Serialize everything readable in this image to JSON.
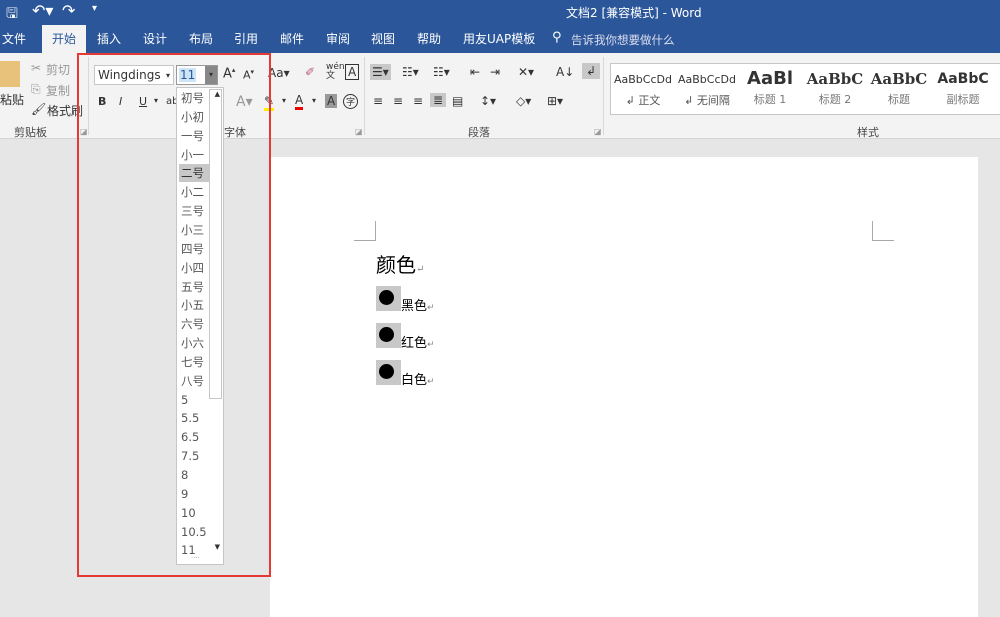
{
  "title_bar": {
    "title": "文档2 [兼容模式]  -  Word"
  },
  "tabs": [
    {
      "label": "文件"
    },
    {
      "label": "开始"
    },
    {
      "label": "插入"
    },
    {
      "label": "设计"
    },
    {
      "label": "布局"
    },
    {
      "label": "引用"
    },
    {
      "label": "邮件"
    },
    {
      "label": "审阅"
    },
    {
      "label": "视图"
    },
    {
      "label": "帮助"
    },
    {
      "label": "用友UAP模板"
    }
  ],
  "tell_me": "告诉我你想要做什么",
  "clipboard": {
    "paste": "粘贴",
    "cut": "剪切",
    "copy": "复制",
    "format_painter": "格式刷",
    "label": "剪贴板"
  },
  "font": {
    "name": "Wingdings",
    "size": "11",
    "label": "字体",
    "bold": "B",
    "italic": "I",
    "underline": "U"
  },
  "paragraph": {
    "label": "段落"
  },
  "styles": {
    "label": "样式",
    "items": [
      {
        "preview": "AaBbCcDd",
        "name": "↲ 正文"
      },
      {
        "preview": "AaBbCcDd",
        "name": "↲ 无间隔"
      },
      {
        "preview": "AaBl",
        "name": "标题 1"
      },
      {
        "preview": "AaBbC",
        "name": "标题 2"
      },
      {
        "preview": "AaBbC",
        "name": "标题"
      },
      {
        "preview": "AaBbC",
        "name": "副标题"
      }
    ]
  },
  "font_size_list": {
    "selected": "二号",
    "options": [
      "初号",
      "小初",
      "一号",
      "小一",
      "二号",
      "小二",
      "三号",
      "小三",
      "四号",
      "小四",
      "五号",
      "小五",
      "六号",
      "小六",
      "七号",
      "八号",
      "5",
      "5.5",
      "6.5",
      "7.5",
      "8",
      "9",
      "10",
      "10.5",
      "11"
    ]
  },
  "document": {
    "heading": "颜色",
    "items": [
      {
        "label": "黑色"
      },
      {
        "label": "红色"
      },
      {
        "label": "白色"
      }
    ],
    "para_mark": "↵"
  }
}
